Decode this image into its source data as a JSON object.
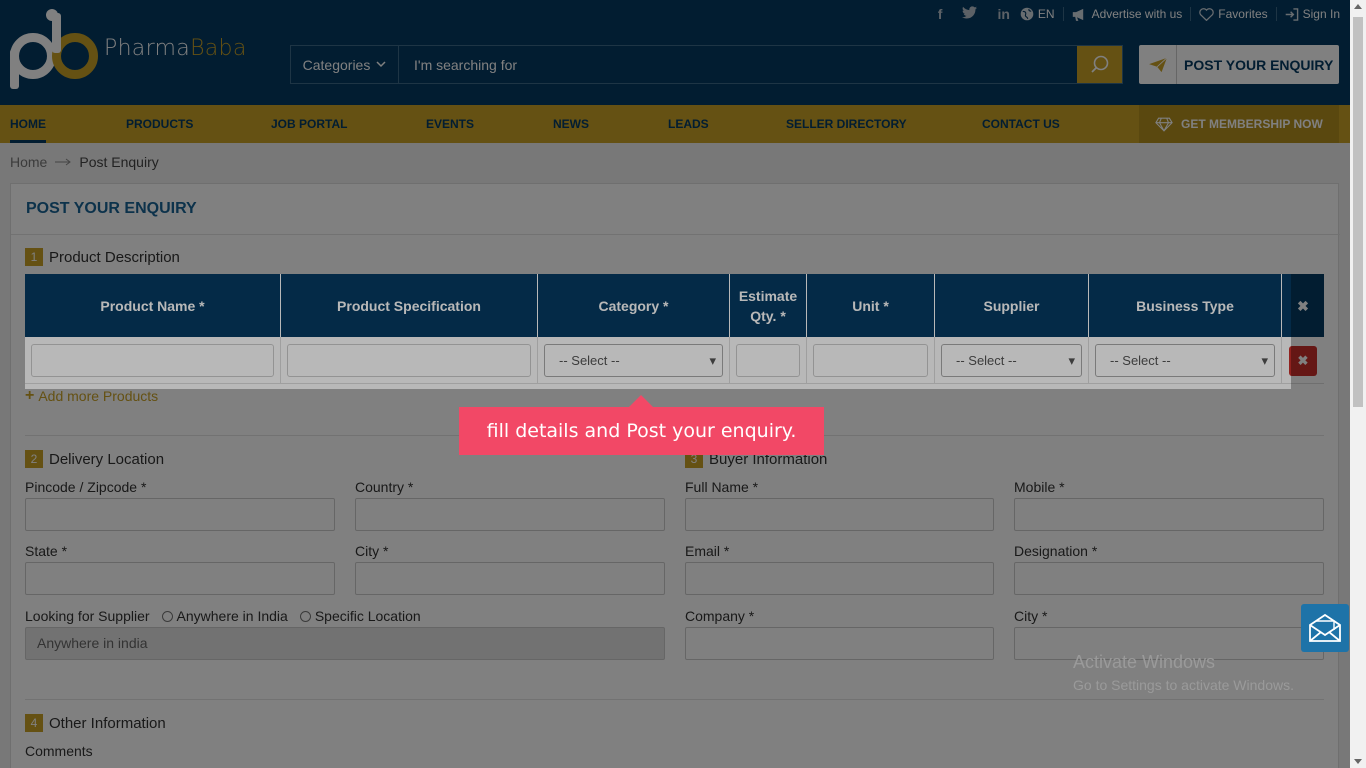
{
  "brand": {
    "name_part1": "Pharma",
    "name_part2": "Baba"
  },
  "topbar": {
    "lang": "EN",
    "advertise": "Advertise with us",
    "favorites": "Favorites",
    "signin": "Sign In"
  },
  "search": {
    "category_label": "Categories",
    "placeholder": "I'm searching for"
  },
  "post_enquiry_button": "POST YOUR ENQUIRY",
  "nav": {
    "items": [
      "HOME",
      "PRODUCTS",
      "JOB PORTAL",
      "EVENTS",
      "NEWS",
      "LEADS",
      "SELLER DIRECTORY",
      "CONTACT US"
    ],
    "membership": "GET MEMBERSHIP NOW"
  },
  "breadcrumb": {
    "home": "Home",
    "current": "Post Enquiry"
  },
  "form": {
    "title": "POST YOUR ENQUIRY",
    "section1": {
      "num": "1",
      "title": "Product Description"
    },
    "table": {
      "headers": [
        "Product Name *",
        "Product Specification",
        "Category *",
        "Estimate Qty. *",
        "Unit *",
        "Supplier",
        "Business Type"
      ],
      "select_placeholder": "-- Select --"
    },
    "add_more": "Add more Products",
    "section2": {
      "num": "2",
      "title": "Delivery Location"
    },
    "section3": {
      "num": "3",
      "title": "Buyer Information"
    },
    "section4": {
      "num": "4",
      "title": "Other Information"
    },
    "labels": {
      "pincode": "Pincode / Zipcode *",
      "country": "Country *",
      "state": "State *",
      "city": "City *",
      "looking_for": "Looking for Supplier",
      "anywhere": "Anywhere in India",
      "specific": "Specific Location",
      "anywhere_value": "Anywhere in india",
      "full_name": "Full Name *",
      "mobile": "Mobile *",
      "email": "Email *",
      "designation": "Designation *",
      "company": "Company *",
      "buyer_city": "City *",
      "comments": "Comments"
    }
  },
  "tooltip": "fill details and Post your enquiry.",
  "watermark": {
    "line1": "Activate Windows",
    "line2": "Go to Settings to activate Windows."
  },
  "colors": {
    "navy": "#063b63",
    "gold": "#c9a227",
    "tooltip": "#f24866"
  }
}
